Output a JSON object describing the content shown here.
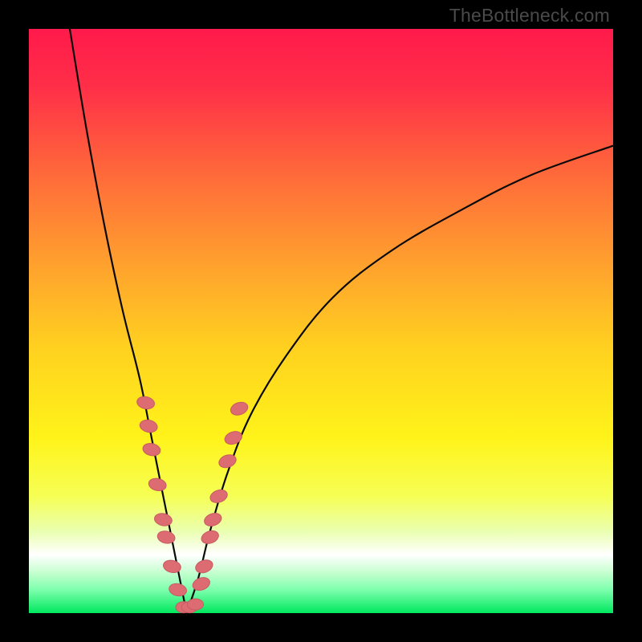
{
  "watermark": "TheBottleneck.com",
  "chart_data": {
    "type": "line",
    "title": "",
    "xlabel": "",
    "ylabel": "",
    "xlim": [
      0,
      100
    ],
    "ylim": [
      0,
      100
    ],
    "x_optimum": 27,
    "curve_description": "V-shaped bottleneck curve with minimum near x≈27%; left branch descends steeply from ~100 at x≈7 to 0 at x≈27; right branch rises with decreasing slope toward ~80 at x=100.",
    "series": [
      {
        "name": "bottleneck-curve",
        "x": [
          7,
          10,
          13,
          16,
          19,
          21,
          23,
          25,
          27,
          29,
          31,
          34,
          38,
          44,
          52,
          62,
          74,
          86,
          100
        ],
        "y": [
          100,
          82,
          66,
          52,
          40,
          30,
          20,
          10,
          0,
          6,
          14,
          24,
          34,
          44,
          54,
          62,
          69,
          75,
          80
        ]
      }
    ],
    "sample_points": {
      "description": "Pink bead-shaped markers clustered along the lower arms of the V",
      "left_arm": [
        {
          "x": 20,
          "y": 36
        },
        {
          "x": 20.5,
          "y": 32
        },
        {
          "x": 21,
          "y": 28
        },
        {
          "x": 22,
          "y": 22
        },
        {
          "x": 23,
          "y": 16
        },
        {
          "x": 23.5,
          "y": 13
        },
        {
          "x": 24.5,
          "y": 8
        },
        {
          "x": 25.5,
          "y": 4
        }
      ],
      "valley": [
        {
          "x": 26.5,
          "y": 1
        },
        {
          "x": 27.5,
          "y": 1
        },
        {
          "x": 28.5,
          "y": 1.5
        }
      ],
      "right_arm": [
        {
          "x": 29.5,
          "y": 5
        },
        {
          "x": 30,
          "y": 8
        },
        {
          "x": 31,
          "y": 13
        },
        {
          "x": 31.5,
          "y": 16
        },
        {
          "x": 32.5,
          "y": 20
        },
        {
          "x": 34,
          "y": 26
        },
        {
          "x": 35,
          "y": 30
        },
        {
          "x": 36,
          "y": 35
        }
      ]
    },
    "background_gradient": {
      "stops": [
        {
          "pos": 0.0,
          "color": "#ff1a4b"
        },
        {
          "pos": 0.1,
          "color": "#ff2f48"
        },
        {
          "pos": 0.25,
          "color": "#ff6a3a"
        },
        {
          "pos": 0.4,
          "color": "#ffa02e"
        },
        {
          "pos": 0.55,
          "color": "#ffd21f"
        },
        {
          "pos": 0.7,
          "color": "#fff31a"
        },
        {
          "pos": 0.8,
          "color": "#f6ff55"
        },
        {
          "pos": 0.86,
          "color": "#eaffb0"
        },
        {
          "pos": 0.9,
          "color": "#ffffff"
        },
        {
          "pos": 0.93,
          "color": "#c7ffd0"
        },
        {
          "pos": 0.96,
          "color": "#7dffad"
        },
        {
          "pos": 1.0,
          "color": "#00e85e"
        }
      ]
    },
    "colors": {
      "curve": "#0a0a0a",
      "marker_fill": "#dd6b72",
      "marker_stroke": "#c75b63"
    }
  }
}
